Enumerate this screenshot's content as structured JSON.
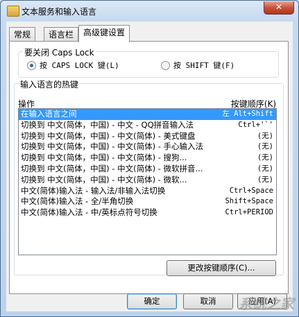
{
  "window": {
    "title": "文本服务和输入语言",
    "close_label": "✕"
  },
  "tabs": [
    {
      "label": "常规",
      "active": false
    },
    {
      "label": "语言栏",
      "active": false
    },
    {
      "label": "高级键设置",
      "active": true
    }
  ],
  "caps_lock": {
    "group_title": "要关闭 Caps Lock",
    "options": [
      {
        "label": "按 CAPS LOCK 键(L)",
        "selected": true
      },
      {
        "label": "按 SHIFT 键(F)",
        "selected": false
      }
    ]
  },
  "hotkeys": {
    "group_title": "输入语言的热键",
    "col_action": "操作",
    "col_keys": "按键顺序(K)",
    "rows": [
      {
        "action": "在输入语言之间",
        "keys": "左 Alt+Shift",
        "selected": true
      },
      {
        "action": "切换到 中文(简体，中国) - 中文 - QQ拼音输入法",
        "keys": "Ctrl+'`'",
        "selected": false
      },
      {
        "action": "切换到 中文(简体，中国) - 中文(简体) - 美式键盘",
        "keys": "(无)",
        "selected": false
      },
      {
        "action": "切换到 中文(简体，中国) - 中文(简体) - 手心输入法",
        "keys": "(无)",
        "selected": false
      },
      {
        "action": "切换到 中文(简体，中国) - 中文(简体) - 搜狗...",
        "keys": "(无)",
        "selected": false
      },
      {
        "action": "切换到 中文(简体，中国) - 中文(简体) - 微软拼音...",
        "keys": "(无)",
        "selected": false
      },
      {
        "action": "切换到 中文(简体，中国) - 中文(简体) - 微软...",
        "keys": "(无)",
        "selected": false
      },
      {
        "action": "中文(简体)输入法 - 输入法/非输入法切换",
        "keys": "Ctrl+Space",
        "selected": false
      },
      {
        "action": "中文(简体)输入法 - 全/半角切换",
        "keys": "Shift+Space",
        "selected": false
      },
      {
        "action": "中文(简体)输入法 - 中/英标点符号切换",
        "keys": "Ctrl+PERIOD",
        "selected": false
      }
    ],
    "change_button": "更改按键顺序(C)..."
  },
  "footer": {
    "ok": "确定",
    "cancel": "取消",
    "apply": "应用(A)"
  },
  "watermark": "系统之家"
}
